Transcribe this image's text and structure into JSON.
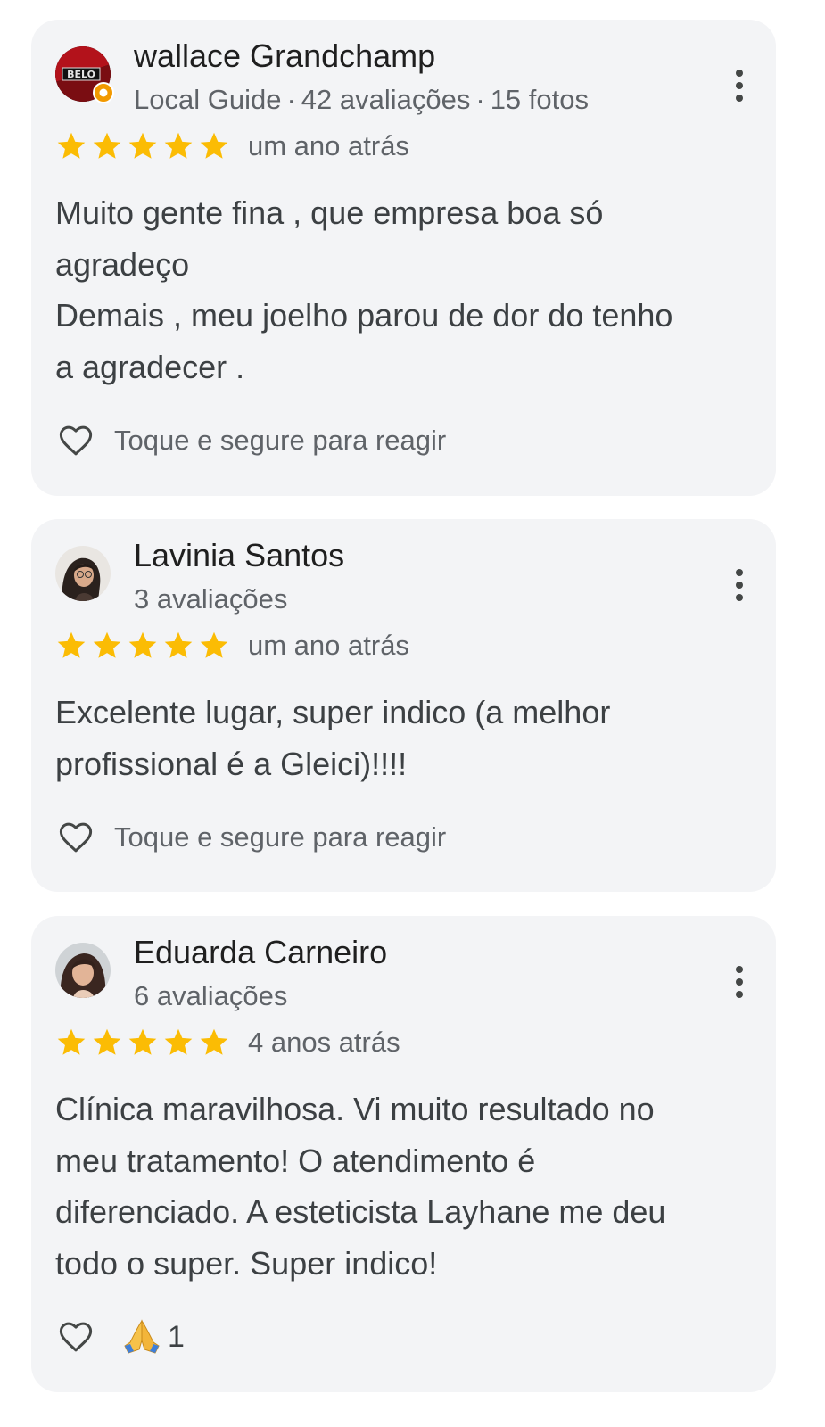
{
  "reviews": [
    {
      "author": "wallace Grandchamp",
      "meta_parts": [
        "Local Guide",
        "42 avaliações",
        "15 fotos"
      ],
      "meta_separator": "·",
      "rating": 5,
      "when": "um ano atrás",
      "text": "Muito gente fina , que empresa boa só\nagradeço\nDemais , meu joelho parou de dor do tenho\na agradecer .",
      "react_label": "Toque e segure para reagir",
      "avatar_text": "BELO"
    },
    {
      "author": "Lavinia Santos",
      "meta_parts": [
        "3 avaliações"
      ],
      "rating": 5,
      "when": "um ano atrás",
      "text": "Excelente lugar, super indico (a melhor\nprofissional é a Gleici)!!!!",
      "react_label": "Toque e segure para reagir"
    },
    {
      "author": "Eduarda Carneiro",
      "meta_parts": [
        "6 avaliações"
      ],
      "rating": 5,
      "when": "4 anos atrás",
      "text": "Clínica maravilhosa. Vi muito resultado no\nmeu tratamento! O atendimento é\ndiferenciado. A esteticista Layhane me deu\ntodo o super. Super indico!",
      "reaction_emoji": "🙏",
      "reaction_count": "1"
    }
  ],
  "colors": {
    "card_bg": "#f3f4f6",
    "star": "#fbbc04",
    "secondary_text": "#5f6368"
  },
  "icons": {
    "star": "star-icon",
    "heart": "heart-outline-icon",
    "more": "more-vert-icon",
    "pray": "folded-hands-emoji"
  }
}
